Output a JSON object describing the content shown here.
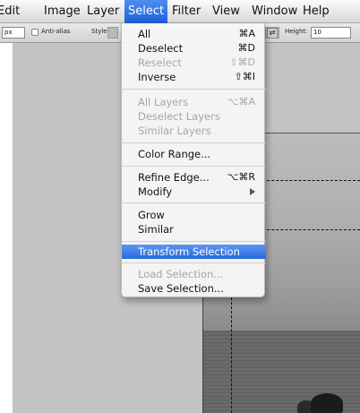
{
  "menubar": {
    "items": [
      "Edit",
      "Image",
      "Layer",
      "Select",
      "Filter",
      "View",
      "Window",
      "Help"
    ],
    "active": "Select"
  },
  "options": {
    "feather_value": "px",
    "anti_alias_label": "Anti-alias",
    "style_label": "Style:",
    "height_label": "Height:",
    "height_value": "10"
  },
  "menu": {
    "items": [
      {
        "label": "All",
        "shortcut": "⌘A",
        "enabled": true
      },
      {
        "label": "Deselect",
        "shortcut": "⌘D",
        "enabled": true
      },
      {
        "label": "Reselect",
        "shortcut": "⇧⌘D",
        "enabled": false
      },
      {
        "label": "Inverse",
        "shortcut": "⇧⌘I",
        "enabled": true
      },
      {
        "label": "All Layers",
        "shortcut": "⌥⌘A",
        "enabled": false
      },
      {
        "label": "Deselect Layers",
        "shortcut": "",
        "enabled": false
      },
      {
        "label": "Similar Layers",
        "shortcut": "",
        "enabled": false
      },
      {
        "label": "Color Range...",
        "shortcut": "",
        "enabled": true
      },
      {
        "label": "Refine Edge...",
        "shortcut": "⌥⌘R",
        "enabled": true
      },
      {
        "label": "Modify",
        "shortcut": "",
        "enabled": true,
        "submenu": true
      },
      {
        "label": "Grow",
        "shortcut": "",
        "enabled": true
      },
      {
        "label": "Similar",
        "shortcut": "",
        "enabled": true
      },
      {
        "label": "Transform Selection",
        "shortcut": "",
        "enabled": true,
        "highlighted": true
      },
      {
        "label": "Load Selection...",
        "shortcut": "",
        "enabled": false
      },
      {
        "label": "Save Selection...",
        "shortcut": "",
        "enabled": true
      }
    ]
  }
}
